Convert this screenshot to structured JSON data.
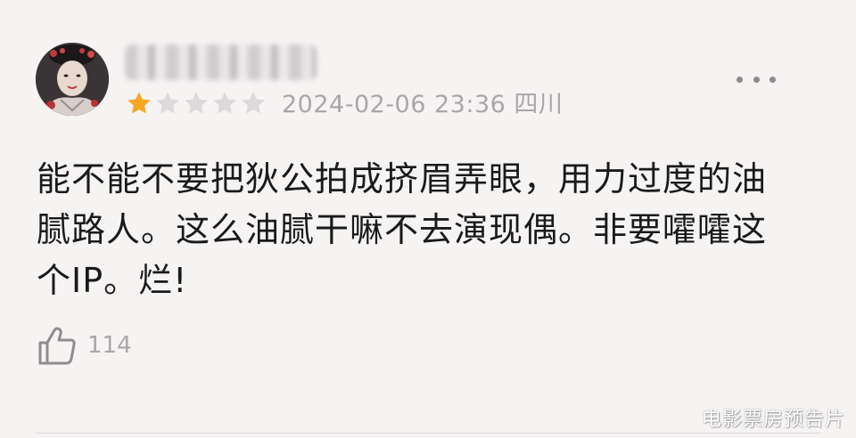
{
  "review": {
    "rating": 1,
    "rating_max": 5,
    "date": "2024-02-06 23:36",
    "location": "四川",
    "meta_text": "2024-02-06 23:36 四川",
    "text_lines": [
      "能不能不要把狄公拍成挤眉弄眼，用力过度的油",
      "腻路人。这么油腻干嘛不去演现偶。非要嚯嚯这",
      "个IP。烂!"
    ],
    "like_count": "114"
  },
  "watermark": "电影票房预告片",
  "icons": {
    "star_filled": "star-filled-icon",
    "star_empty": "star-empty-icon",
    "more": "more-icon",
    "like": "thumbs-up-icon"
  },
  "colors": {
    "background": "#f6f3f3",
    "star_filled": "#f5a623",
    "star_empty": "#dcd9da",
    "secondary_text": "#a9a6a8",
    "primary_text": "#1a1a1a"
  }
}
